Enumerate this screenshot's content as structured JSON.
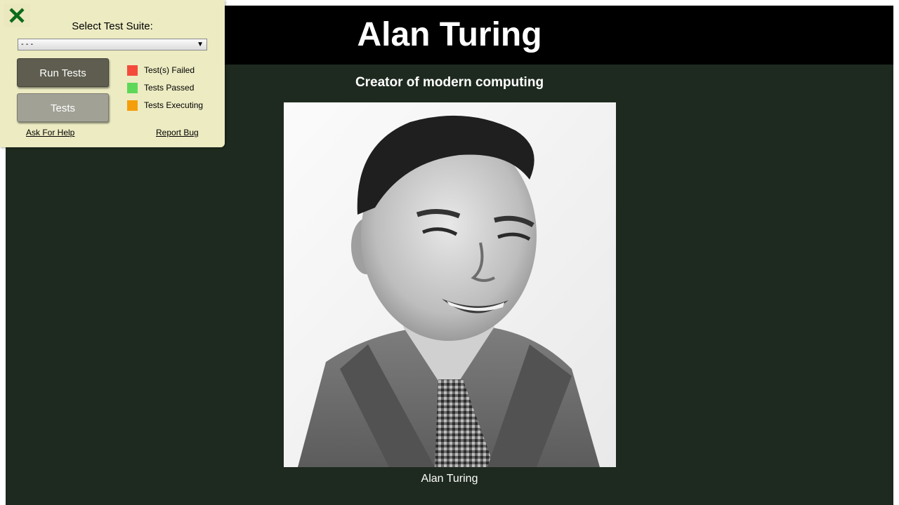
{
  "header": {
    "title": "Alan Turing"
  },
  "subtitle": "Creator of modern computing",
  "caption": "Alan Turing",
  "test_panel": {
    "label": "Select Test Suite:",
    "selected_suite": "- - -",
    "run_tests_label": "Run Tests",
    "tests_label": "Tests",
    "legend": [
      {
        "label": "Test(s) Failed",
        "color": "#f44b3b"
      },
      {
        "label": "Tests Passed",
        "color": "#5fd859"
      },
      {
        "label": "Tests Executing",
        "color": "#f59e0b"
      }
    ],
    "ask_for_help": "Ask For Help",
    "report_bug": "Report Bug",
    "close_icon": "close-icon",
    "close_color": "#0b6b1a"
  },
  "colors": {
    "page_background": "#1e2a1f",
    "header_background": "#000000",
    "panel_background": "#ecebc2"
  }
}
